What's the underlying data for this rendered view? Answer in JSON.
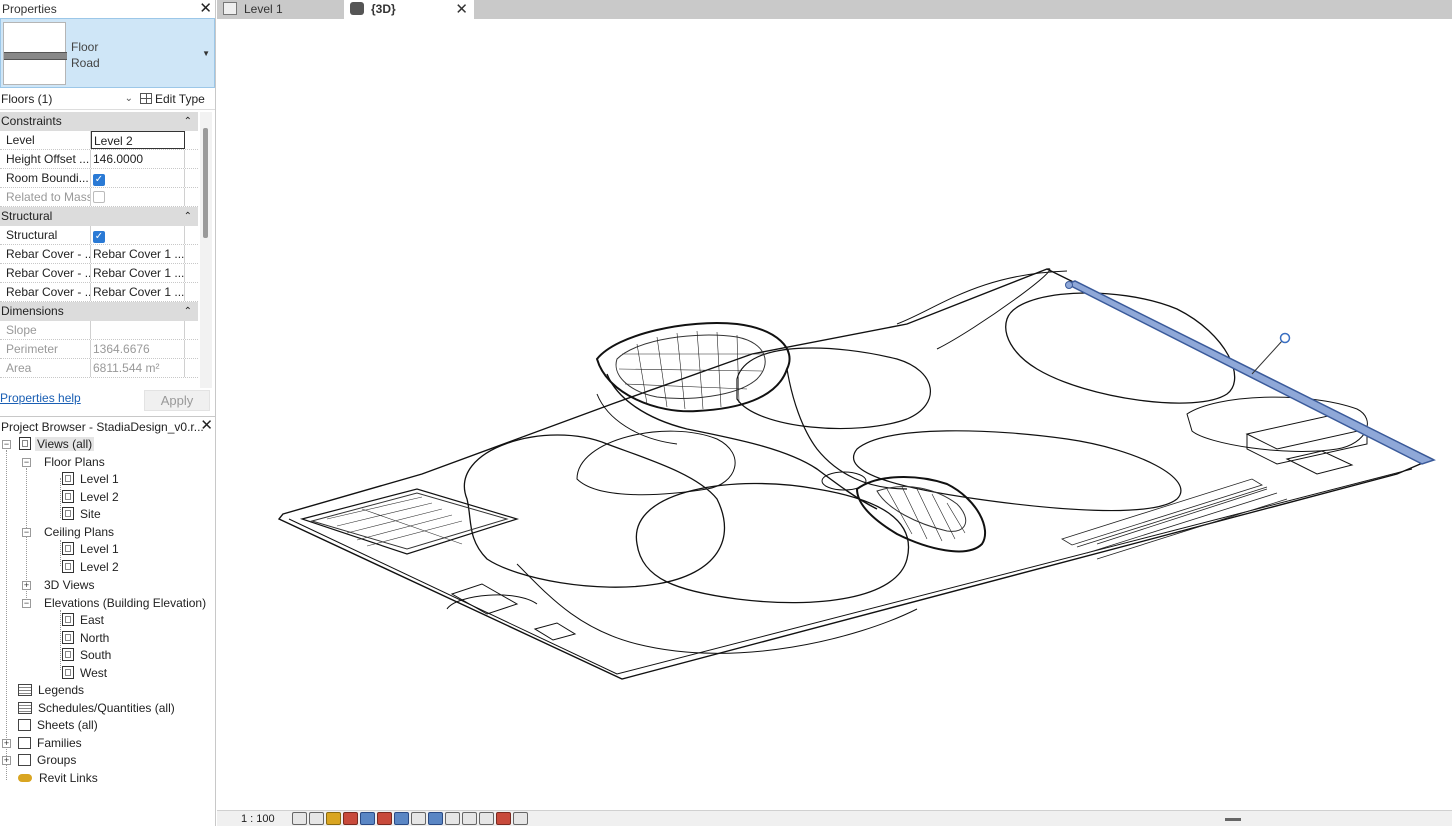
{
  "properties": {
    "title": "Properties",
    "type_family": "Floor",
    "type_name": "Road",
    "instance_filter": "Floors (1)",
    "edit_type_label": "Edit Type",
    "groups": [
      {
        "name": "Constraints",
        "rows": [
          {
            "name": "Level",
            "value": "Level 2"
          },
          {
            "name": "Height Offset ...",
            "value": "146.0000"
          },
          {
            "name": "Room Boundi...",
            "value": "",
            "checked": true
          },
          {
            "name": "Related to Mass",
            "value": "",
            "checked": false
          }
        ]
      },
      {
        "name": "Structural",
        "rows": [
          {
            "name": "Structural",
            "value": "",
            "checked": true
          },
          {
            "name": "Rebar Cover - ...",
            "value": "Rebar Cover 1 ..."
          },
          {
            "name": "Rebar Cover - ...",
            "value": "Rebar Cover 1 ..."
          },
          {
            "name": "Rebar Cover - ...",
            "value": "Rebar Cover 1 ..."
          }
        ]
      },
      {
        "name": "Dimensions",
        "rows": [
          {
            "name": "Slope",
            "value": ""
          },
          {
            "name": "Perimeter",
            "value": "1364.6676"
          },
          {
            "name": "Area",
            "value": "6811.544 m²"
          }
        ]
      }
    ],
    "help_link": "Properties help",
    "apply_label": "Apply"
  },
  "project_browser": {
    "title": "Project Browser - StadiaDesign_v0.r...",
    "tree": {
      "views_all": "Views (all)",
      "floor_plans": "Floor Plans",
      "fp_level1": "Level 1",
      "fp_level2": "Level 2",
      "fp_site": "Site",
      "ceiling_plans": "Ceiling Plans",
      "cp_level1": "Level 1",
      "cp_level2": "Level 2",
      "views_3d": "3D Views",
      "elevations": "Elevations (Building Elevation)",
      "el_east": "East",
      "el_north": "North",
      "el_south": "South",
      "el_west": "West",
      "legends": "Legends",
      "schedules": "Schedules/Quantities (all)",
      "sheets": "Sheets (all)",
      "families": "Families",
      "groups": "Groups",
      "revit_links": "Revit Links"
    }
  },
  "tabs": [
    {
      "label": "Level 1",
      "active": false
    },
    {
      "label": "{3D}",
      "active": true
    }
  ],
  "status": {
    "scale": "1 : 100"
  },
  "colors": {
    "selection_highlight": "#cfe6f7",
    "selected_element": "#8fa8d8",
    "link": "#1a5fb4"
  }
}
